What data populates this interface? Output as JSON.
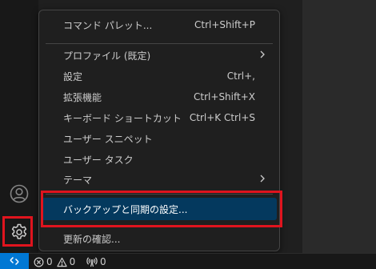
{
  "menu": {
    "items": [
      {
        "label": "コマンド パレット...",
        "shortcut": "Ctrl+Shift+P"
      },
      {
        "label": "プロファイル (既定)",
        "shortcut": ""
      },
      {
        "label": "設定",
        "shortcut": "Ctrl+,"
      },
      {
        "label": "拡張機能",
        "shortcut": "Ctrl+Shift+X"
      },
      {
        "label": "キーボード ショートカット",
        "shortcut": "Ctrl+K Ctrl+S"
      },
      {
        "label": "ユーザー スニペット",
        "shortcut": ""
      },
      {
        "label": "ユーザー タスク",
        "shortcut": ""
      },
      {
        "label": "テーマ",
        "shortcut": ""
      },
      {
        "label": "バックアップと同期の設定...",
        "shortcut": ""
      },
      {
        "label": "更新の確認...",
        "shortcut": ""
      }
    ]
  },
  "status": {
    "errors": "0",
    "warnings": "0",
    "ports": "0"
  },
  "icons": {
    "account": "account-icon",
    "manage": "gear-icon",
    "remote": "remote-icon",
    "error": "error-icon",
    "warning": "warning-icon",
    "ports": "broadcast-icon"
  },
  "colors": {
    "accent": "#0078d4",
    "selection": "#04395e",
    "highlight_border": "#e0141e"
  }
}
